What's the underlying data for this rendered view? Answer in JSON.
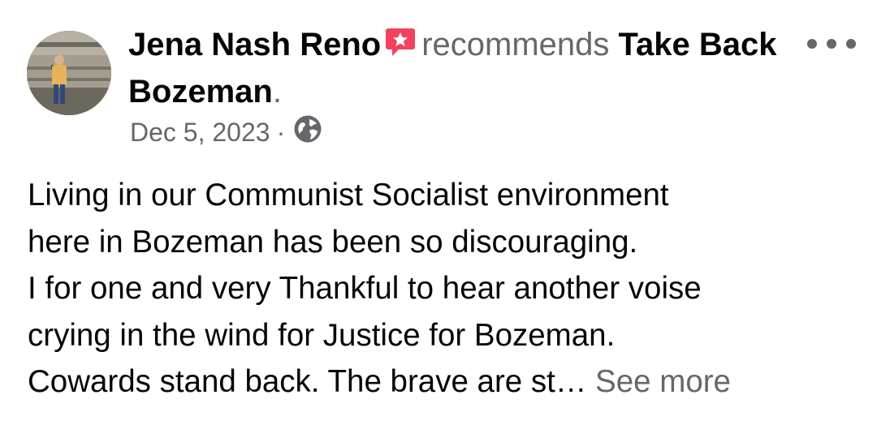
{
  "post": {
    "author": "Jena Nash Reno",
    "action": "recommends",
    "page_name": "Take Back Bozeman",
    "period": ".",
    "date": "Dec 5, 2023",
    "date_separator": "·",
    "privacy_icon": "globe-icon",
    "badge_icon": "recommend-star-icon",
    "body_lines": [
      "Living in our Communist Socialist environment",
      "here in Bozeman has been so discouraging.",
      "I for one and very Thankful to hear another voise",
      "crying in the wind for Justice for Bozeman.",
      "Cowards stand back. The brave are st… "
    ],
    "see_more": "See more"
  },
  "colors": {
    "text_primary": "#050505",
    "text_secondary": "#65676b",
    "badge_red": "#f3425f"
  }
}
